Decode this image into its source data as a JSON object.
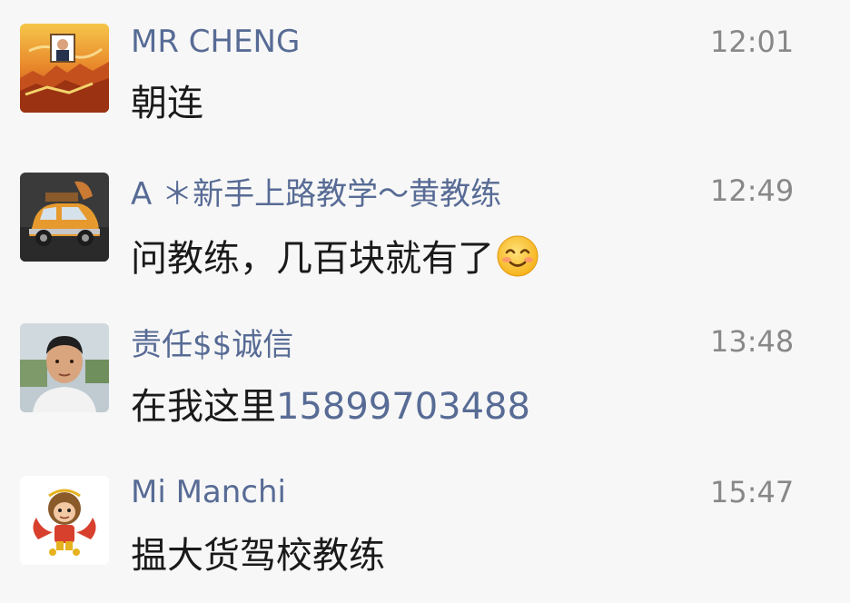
{
  "comments": [
    {
      "avatar_icon": "great-wall-avatar-icon",
      "name": "MR CHENG",
      "time": "12:01",
      "text": "朝连"
    },
    {
      "avatar_icon": "orange-car-avatar-icon",
      "name": "A ＊新手上路教学～黄教练",
      "time": "12:49",
      "text": "问教练，几百块就有了",
      "emoji": "smiling-face-icon"
    },
    {
      "avatar_icon": "man-portrait-avatar-icon",
      "name": "责任$$诚信",
      "time": "13:48",
      "text": "在我这里",
      "phone": "15899703488"
    },
    {
      "avatar_icon": "monkey-king-avatar-icon",
      "name": "Mi Manchi",
      "time": "15:47",
      "text": "揾大货驾校教练"
    }
  ],
  "colors": {
    "background": "#f7f7f7",
    "name": "#576b95",
    "time": "#888888",
    "text": "#1a1a1a",
    "link": "#576b95"
  }
}
